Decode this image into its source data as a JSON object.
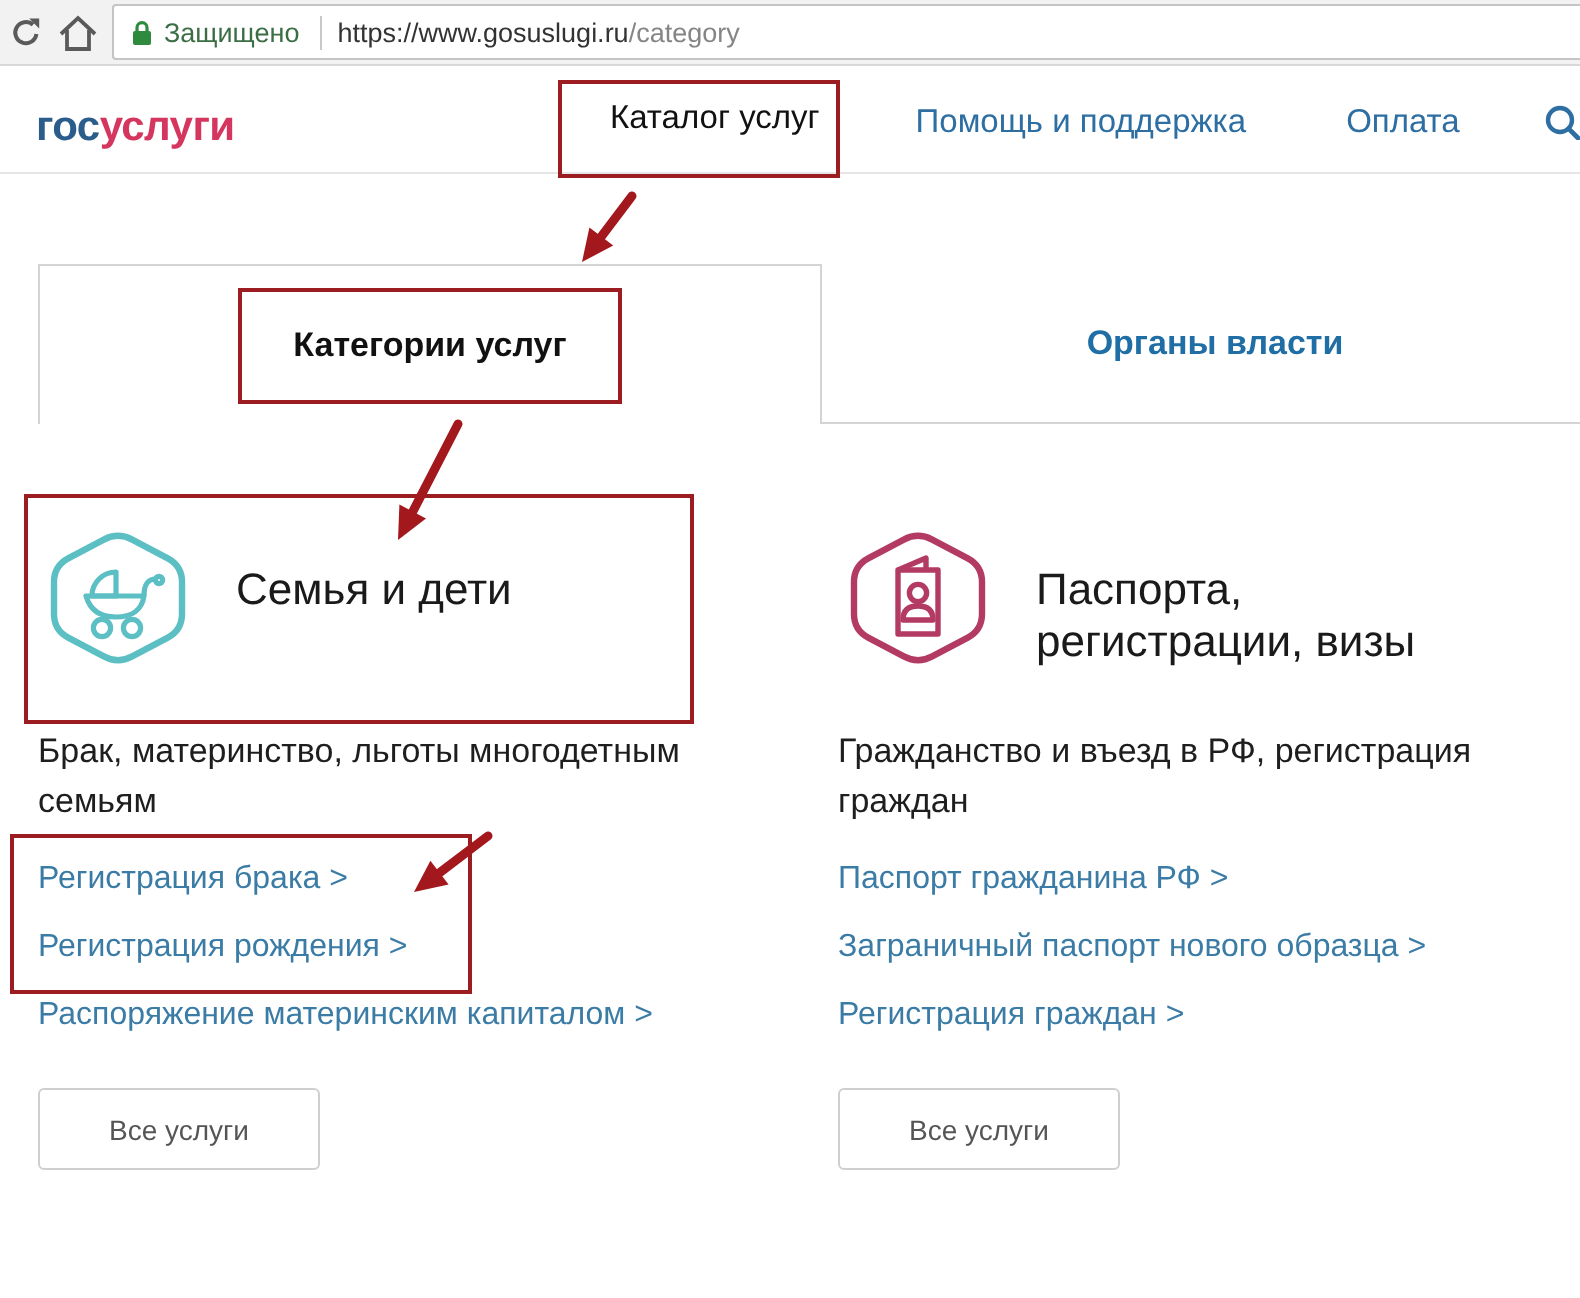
{
  "browser": {
    "security_label": "Защищено",
    "url_origin": "https://www.gosuslugi.ru",
    "url_path": "/category"
  },
  "header": {
    "logo": {
      "first_part": "гос",
      "second_part": "услуги"
    },
    "nav": [
      {
        "label": "Каталог услуг",
        "selected": true,
        "highlighted": true
      },
      {
        "label": "Помощь и поддержка",
        "selected": false,
        "highlighted": false
      },
      {
        "label": "Оплата",
        "selected": false,
        "highlighted": false
      }
    ]
  },
  "tabs": [
    {
      "label": "Категории услуг",
      "selected": true,
      "highlighted": true
    },
    {
      "label": "Органы власти",
      "selected": false,
      "highlighted": false
    }
  ],
  "categories": [
    {
      "kind": "family",
      "color": "#5bbfc4",
      "title": "Семья и дети",
      "highlighted": true,
      "description": "Брак, материнство, льготы многодетным семьям",
      "links": [
        {
          "label": "Регистрация брака >",
          "highlighted": true
        },
        {
          "label": "Регистрация рождения >",
          "highlighted": true
        },
        {
          "label": "Распоряжение материнским капиталом >",
          "highlighted": false
        }
      ],
      "button": "Все услуги"
    },
    {
      "kind": "passport",
      "color": "#b23a63",
      "title": "Паспорта, регистрации, визы",
      "highlighted": false,
      "description": "Гражданство и въезд в РФ, регистрация граждан",
      "links": [
        {
          "label": "Паспорт гражданина РФ >",
          "highlighted": false
        },
        {
          "label": "Заграничный паспорт нового образца >",
          "highlighted": false
        },
        {
          "label": "Регистрация граждан >",
          "highlighted": false
        }
      ],
      "button": "Все услуги"
    }
  ]
}
